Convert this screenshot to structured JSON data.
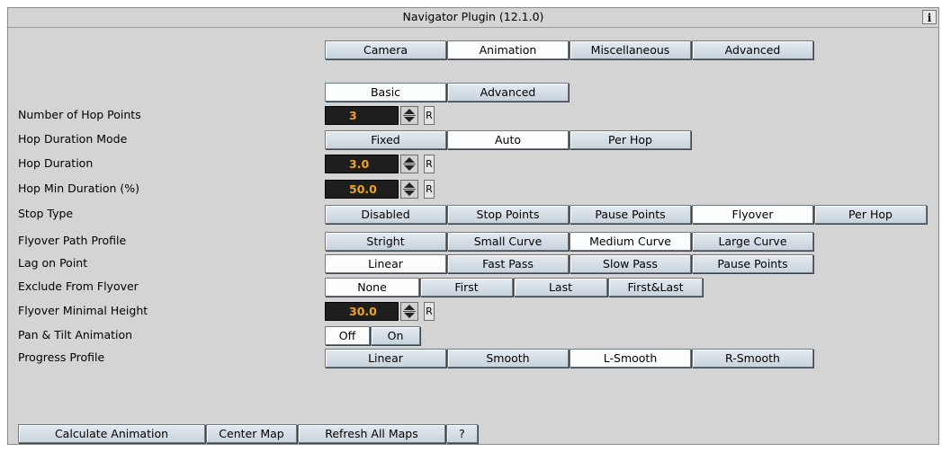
{
  "window": {
    "title": "Navigator Plugin (12.1.0)",
    "info_label": "i"
  },
  "main_tabs": [
    "Camera",
    "Animation",
    "Miscellaneous",
    "Advanced"
  ],
  "sub_tabs": [
    "Basic",
    "Advanced"
  ],
  "labels": {
    "hop_points": "Number of Hop Points",
    "hop_duration_mode": "Hop Duration Mode",
    "hop_duration": "Hop Duration",
    "hop_min_duration": "Hop Min Duration (%)",
    "stop_type": "Stop Type",
    "flyover_path_profile": "Flyover Path Profile",
    "lag_on_point": "Lag on Point",
    "exclude_from_flyover": "Exclude From Flyover",
    "flyover_min_height": "Flyover Minimal Height",
    "pan_tilt": "Pan & Tilt Animation",
    "progress_profile": "Progress Profile"
  },
  "values": {
    "hop_points": "3",
    "hop_duration": "3.0",
    "hop_min_duration": "50.0",
    "flyover_min_height": "30.0"
  },
  "reset_label": "R",
  "options": {
    "hop_duration_mode": [
      "Fixed",
      "Auto",
      "Per Hop"
    ],
    "stop_type": [
      "Disabled",
      "Stop Points",
      "Pause Points",
      "Flyover",
      "Per Hop"
    ],
    "flyover_path_profile": [
      "Stright",
      "Small Curve",
      "Medium Curve",
      "Large Curve"
    ],
    "lag_on_point": [
      "Linear",
      "Fast Pass",
      "Slow Pass",
      "Pause Points"
    ],
    "exclude_from_flyover": [
      "None",
      "First",
      "Last",
      "First&Last"
    ],
    "pan_tilt": [
      "Off",
      "On"
    ],
    "progress_profile": [
      "Linear",
      "Smooth",
      "L-Smooth",
      "R-Smooth"
    ]
  },
  "selected": {
    "main_tab": "Animation",
    "sub_tab": "Basic",
    "hop_duration_mode": "Auto",
    "stop_type": "Flyover",
    "flyover_path_profile": "Medium Curve",
    "lag_on_point": "Linear",
    "exclude_from_flyover": "None",
    "pan_tilt": "Off",
    "progress_profile": "L-Smooth"
  },
  "footer": {
    "calculate": "Calculate  Animation",
    "center_map": "Center Map",
    "refresh_maps": "Refresh All Maps",
    "help": "?"
  }
}
